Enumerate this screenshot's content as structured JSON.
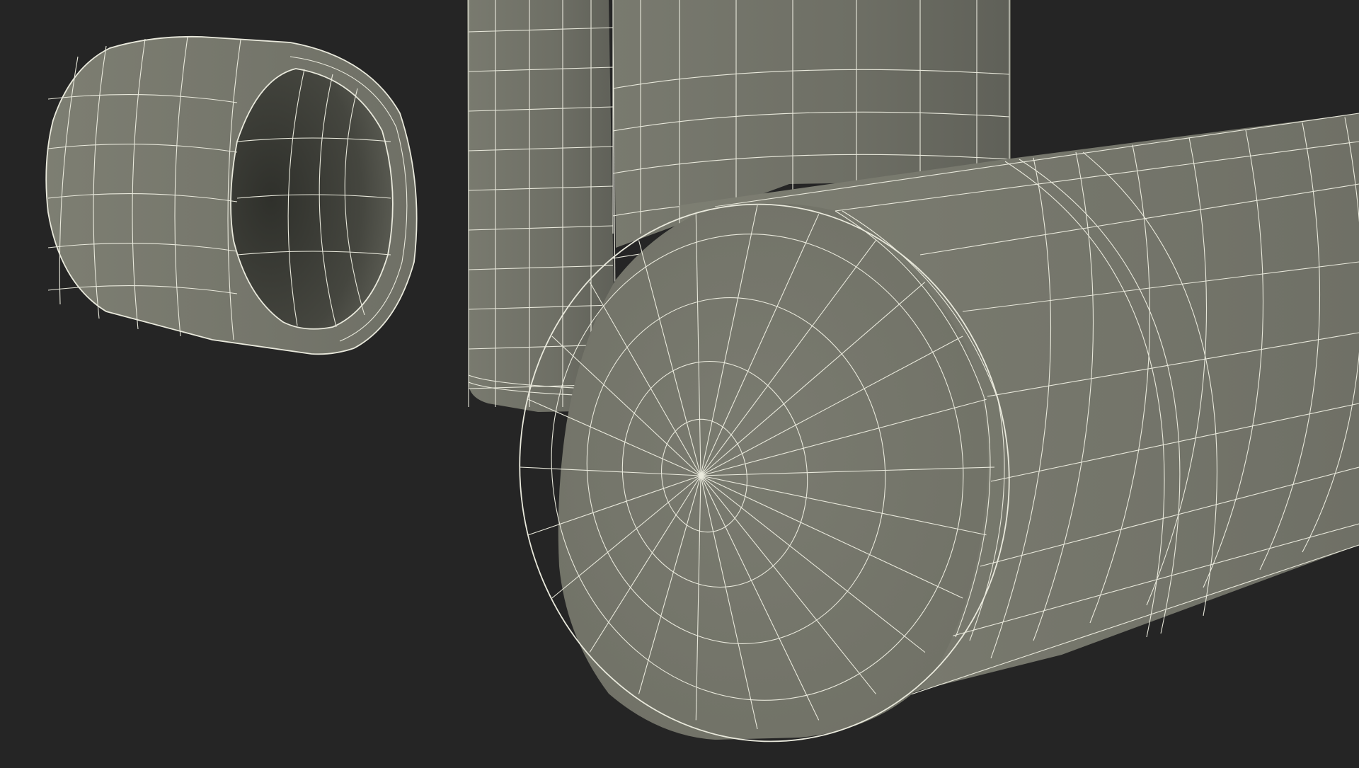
{
  "scene": {
    "type": "3d-wireframe-render",
    "background_color": "#252525",
    "surface_color": "#7a7a6e",
    "wire_color": "#e9e9dc",
    "inner_shadow_color": "#3a3b35"
  },
  "objects": [
    {
      "name": "short-open-ring-tube"
    },
    {
      "name": "tall-back-cylinder-left"
    },
    {
      "name": "tall-back-cylinder-right"
    },
    {
      "name": "long-capped-pipe"
    }
  ]
}
